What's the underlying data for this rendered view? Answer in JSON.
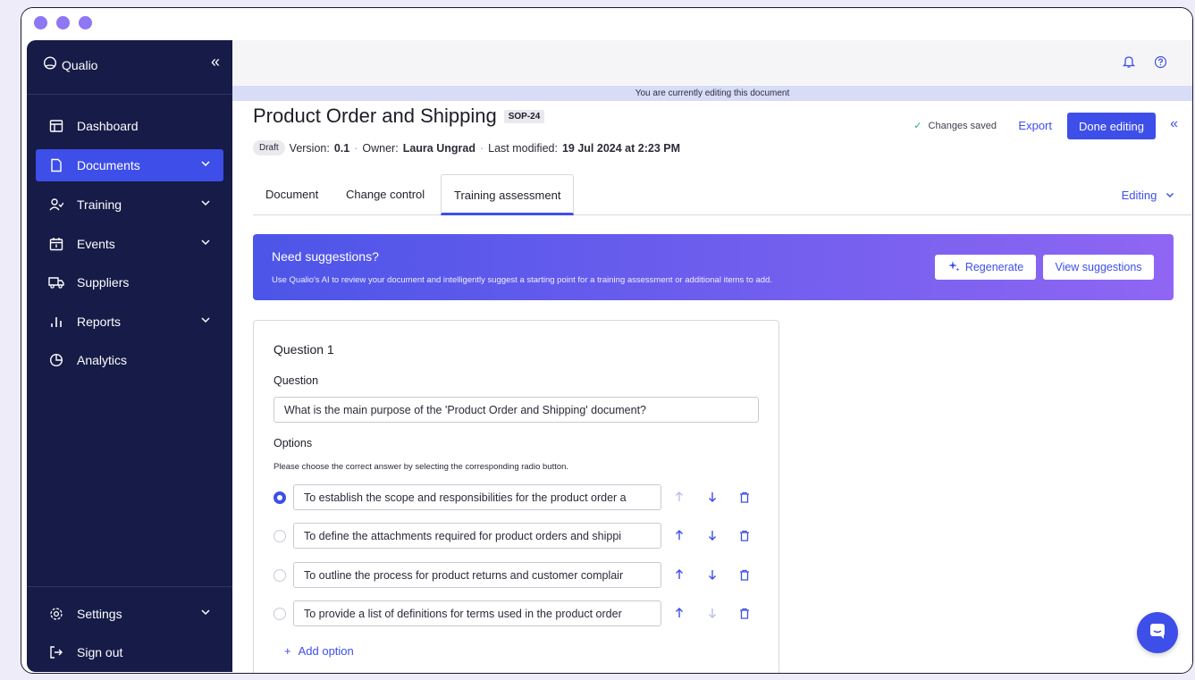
{
  "app": {
    "brand": "Qualio",
    "editing_banner": "You are currently editing this document"
  },
  "sidebar": {
    "items": [
      {
        "label": "Dashboard"
      },
      {
        "label": "Documents"
      },
      {
        "label": "Training"
      },
      {
        "label": "Events"
      },
      {
        "label": "Suppliers"
      },
      {
        "label": "Reports"
      },
      {
        "label": "Analytics"
      }
    ],
    "bottom": [
      {
        "label": "Settings"
      },
      {
        "label": "Sign out"
      }
    ]
  },
  "document": {
    "title": "Product Order and Shipping",
    "code": "SOP-24",
    "status": "Draft",
    "version_label": "Version:",
    "version": "0.1",
    "owner_label": "Owner:",
    "owner": "Laura Ungrad",
    "modified_label": "Last modified:",
    "modified": "19 Jul 2024 at 2:23 PM",
    "sep": "·",
    "saved": "Changes saved",
    "export": "Export",
    "done": "Done editing"
  },
  "tabs": [
    {
      "label": "Document"
    },
    {
      "label": "Change control"
    },
    {
      "label": "Training assessment"
    }
  ],
  "mode": "Editing",
  "suggestions": {
    "title": "Need suggestions?",
    "subtitle": "Use Qualio's AI to review your document and intelligently suggest a starting point for a training assessment or additional items to add.",
    "regenerate": "Regenerate",
    "view": "View suggestions"
  },
  "question": {
    "heading": "Question 1",
    "question_label": "Question",
    "question_value": "What is the main purpose of the 'Product Order and Shipping' document?",
    "options_label": "Options",
    "hint": "Please choose the correct answer by selecting the corresponding radio button.",
    "options": [
      {
        "text": "To establish the scope and responsibilities for the product order a",
        "selected": true
      },
      {
        "text": "To define the attachments required for product orders and shippi",
        "selected": false
      },
      {
        "text": "To outline the process for product returns and customer complair",
        "selected": false
      },
      {
        "text": "To provide a list of definitions for terms used in the product order",
        "selected": false
      }
    ],
    "add_option": "Add option"
  },
  "colors": {
    "accent": "#3e4ee8",
    "sidebar": "#161b47",
    "gradient_start": "#4c55e8",
    "gradient_end": "#8f66f3"
  }
}
